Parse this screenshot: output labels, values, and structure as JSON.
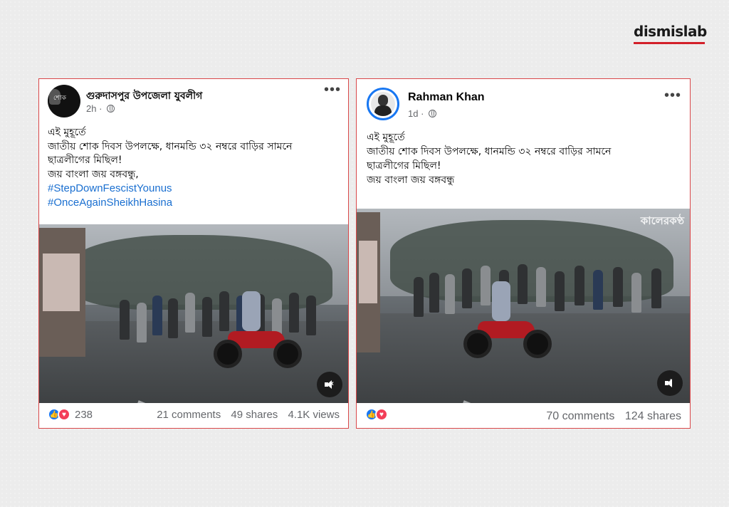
{
  "brand": {
    "logo_text": "dismislab",
    "accent": "#d3202a"
  },
  "posts": [
    {
      "author": "গুরুদাসপুর উপজেলা যুবলীগ",
      "time": "2h",
      "privacy_icon": "globe-icon",
      "avatar_text": "শোক",
      "lines": [
        "এই মুহূর্তে",
        "জাতীয় শোক দিবস উপলক্ষে, ধানমন্ডি ৩২ নম্বরে বাড়ির সামনে",
        "ছাত্রলীগের মিছিল!",
        "জয় বাংলা জয় বঙ্গবন্ধু,"
      ],
      "hashtags": [
        "#StepDownFescistYounus",
        "#OnceAgainSheikhHasina"
      ],
      "video": {
        "sound_icon": "muted-icon"
      },
      "reaction_count": "238",
      "comments": "21 comments",
      "shares": "49 shares",
      "views": "4.1K views"
    },
    {
      "author": "Rahman Khan",
      "time": "1d",
      "privacy_icon": "globe-icon",
      "lines": [
        "এই মুহূর্তে",
        "জাতীয় শোক দিবস উপলক্ষে, ধানমন্ডি ৩২ নম্বরে বাড়ির সামনে",
        "ছাত্রলীগের মিছিল!",
        "জয় বাংলা জয় বঙ্গবন্ধু"
      ],
      "video": {
        "watermark": "কালেরকণ্ঠ",
        "sound_icon": "volume-icon"
      },
      "comments": "70 comments",
      "shares": "124 shares"
    }
  ],
  "colors": {
    "border": "#d9484a",
    "like": "#1877f2",
    "love": "#f33e58",
    "hashtag": "#1a6fd0"
  }
}
